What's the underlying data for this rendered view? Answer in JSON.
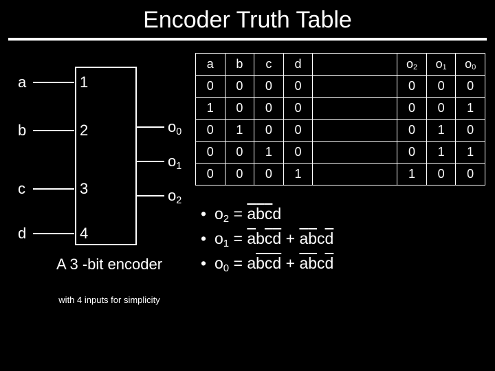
{
  "title": "Encoder Truth Table",
  "encoder": {
    "inputs": [
      {
        "label": "a",
        "num": "1"
      },
      {
        "label": "b",
        "num": "2"
      },
      {
        "label": "c",
        "num": "3"
      },
      {
        "label": "d",
        "num": "4"
      }
    ],
    "outputs": [
      "o 0",
      "o 1",
      "o 2"
    ],
    "caption": "A 3 -bit encoder",
    "caption_small": "with 4 inputs for simplicity"
  },
  "table": {
    "headers_in": [
      "a",
      "b",
      "c",
      "d"
    ],
    "headers_out": [
      "o 2",
      "o 1",
      "o 0"
    ],
    "rows": [
      {
        "in": [
          "0",
          "0",
          "0",
          "0"
        ],
        "out": [
          "0",
          "0",
          "0"
        ]
      },
      {
        "in": [
          "1",
          "0",
          "0",
          "0"
        ],
        "out": [
          "0",
          "0",
          "1"
        ]
      },
      {
        "in": [
          "0",
          "1",
          "0",
          "0"
        ],
        "out": [
          "0",
          "1",
          "0"
        ]
      },
      {
        "in": [
          "0",
          "0",
          "1",
          "0"
        ],
        "out": [
          "0",
          "1",
          "1"
        ]
      },
      {
        "in": [
          "0",
          "0",
          "0",
          "1"
        ],
        "out": [
          "1",
          "0",
          "0"
        ]
      }
    ]
  },
  "equations": {
    "o2": {
      "lhs": "o 2",
      "terms": [
        [
          [
            "a",
            1
          ],
          [
            "b",
            1
          ],
          [
            "c",
            1
          ],
          [
            "d",
            0
          ]
        ]
      ]
    },
    "o1": {
      "lhs": "o 1",
      "terms": [
        [
          [
            "a",
            1
          ],
          [
            "b",
            0
          ],
          [
            "c",
            1
          ],
          [
            "d",
            1
          ]
        ],
        [
          [
            "a",
            1
          ],
          [
            "b",
            1
          ],
          [
            "c",
            0
          ],
          [
            "d",
            1
          ]
        ]
      ]
    },
    "o0": {
      "lhs": "o 0",
      "terms": [
        [
          [
            "a",
            0
          ],
          [
            "b",
            1
          ],
          [
            "c",
            1
          ],
          [
            "d",
            1
          ]
        ],
        [
          [
            "a",
            1
          ],
          [
            "b",
            1
          ],
          [
            "c",
            0
          ],
          [
            "d",
            1
          ]
        ]
      ]
    }
  }
}
